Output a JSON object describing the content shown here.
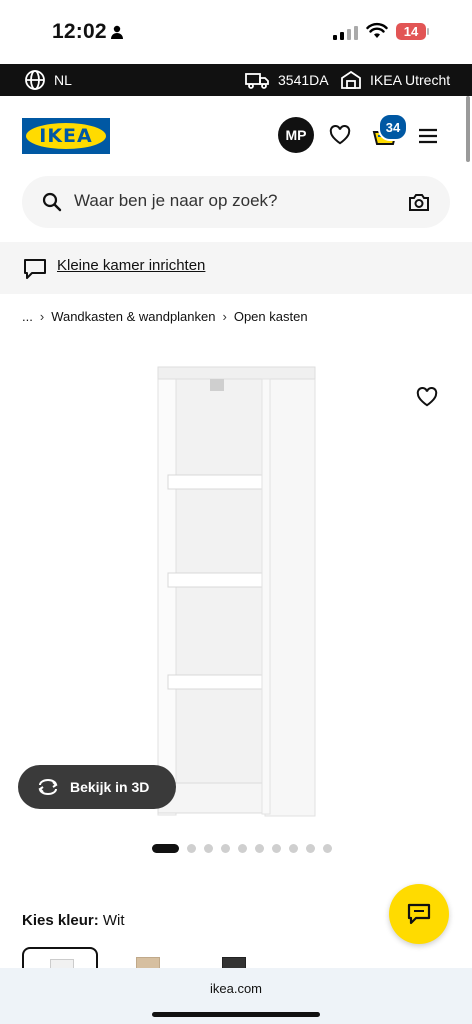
{
  "status_bar": {
    "time": "12:02",
    "battery": "14"
  },
  "top_bar": {
    "language": "NL",
    "postcode": "3541DA",
    "store": "IKEA Utrecht"
  },
  "header": {
    "logo": "IKEA",
    "avatar_initials": "MP",
    "cart_count": "34",
    "icons": [
      "heart-icon",
      "cart-icon",
      "menu-icon"
    ]
  },
  "search": {
    "placeholder": "Waar ben je naar op zoek?"
  },
  "promo": {
    "text": "Kleine kamer inrichten"
  },
  "breadcrumb": {
    "items": [
      "...",
      "Wandkasten & wandplanken",
      "Open kasten"
    ]
  },
  "product": {
    "view_3d_label": "Bekijk in 3D",
    "image_count": 10,
    "active_image": 1
  },
  "color": {
    "label": "Kies kleur:",
    "value": "Wit"
  },
  "browser": {
    "url": "ikea.com"
  },
  "colors": {
    "ikea_blue": "#0058a3",
    "ikea_yellow": "#ffdb00",
    "dark": "#111111"
  }
}
